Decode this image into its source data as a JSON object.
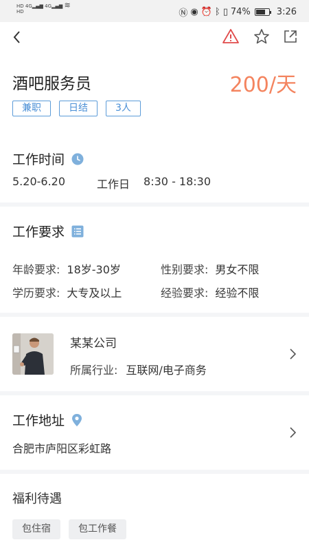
{
  "status_bar": {
    "left_top": "HD",
    "left_bottom": "HD",
    "net1": "4G",
    "net2": "4G",
    "battery_text": "74%",
    "battery_level": 0.74,
    "time": "3:26"
  },
  "nav": {
    "icons": [
      "back-icon",
      "report-warning-icon",
      "favorite-star-icon",
      "share-icon"
    ]
  },
  "job": {
    "title": "酒吧服务员",
    "salary": "200/天",
    "tags": [
      "兼职",
      "日结",
      "3人"
    ]
  },
  "work_time": {
    "title": "工作时间",
    "date_range": "5.20-6.20",
    "days": "工作日",
    "hours": "8:30 - 18:30"
  },
  "requirements": {
    "title": "工作要求",
    "age_label": "年龄要求:",
    "age_value": "18岁-30岁",
    "gender_label": "性别要求:",
    "gender_value": "男女不限",
    "edu_label": "学历要求:",
    "edu_value": "大专及以上",
    "exp_label": "经验要求:",
    "exp_value": "经验不限"
  },
  "company": {
    "name": "某某公司",
    "industry_label": "所属行业:",
    "industry_value": "互联网/电子商务"
  },
  "address": {
    "title": "工作地址",
    "text": "合肥市庐阳区彩虹路"
  },
  "benefits": {
    "title": "福利待遇",
    "items": [
      "包住宿",
      "包工作餐"
    ]
  },
  "colors": {
    "salary": "#f4845f",
    "tag_border": "#5b9bd8",
    "accent_icon": "#7fb0dc",
    "warning": "#e04a4a"
  }
}
